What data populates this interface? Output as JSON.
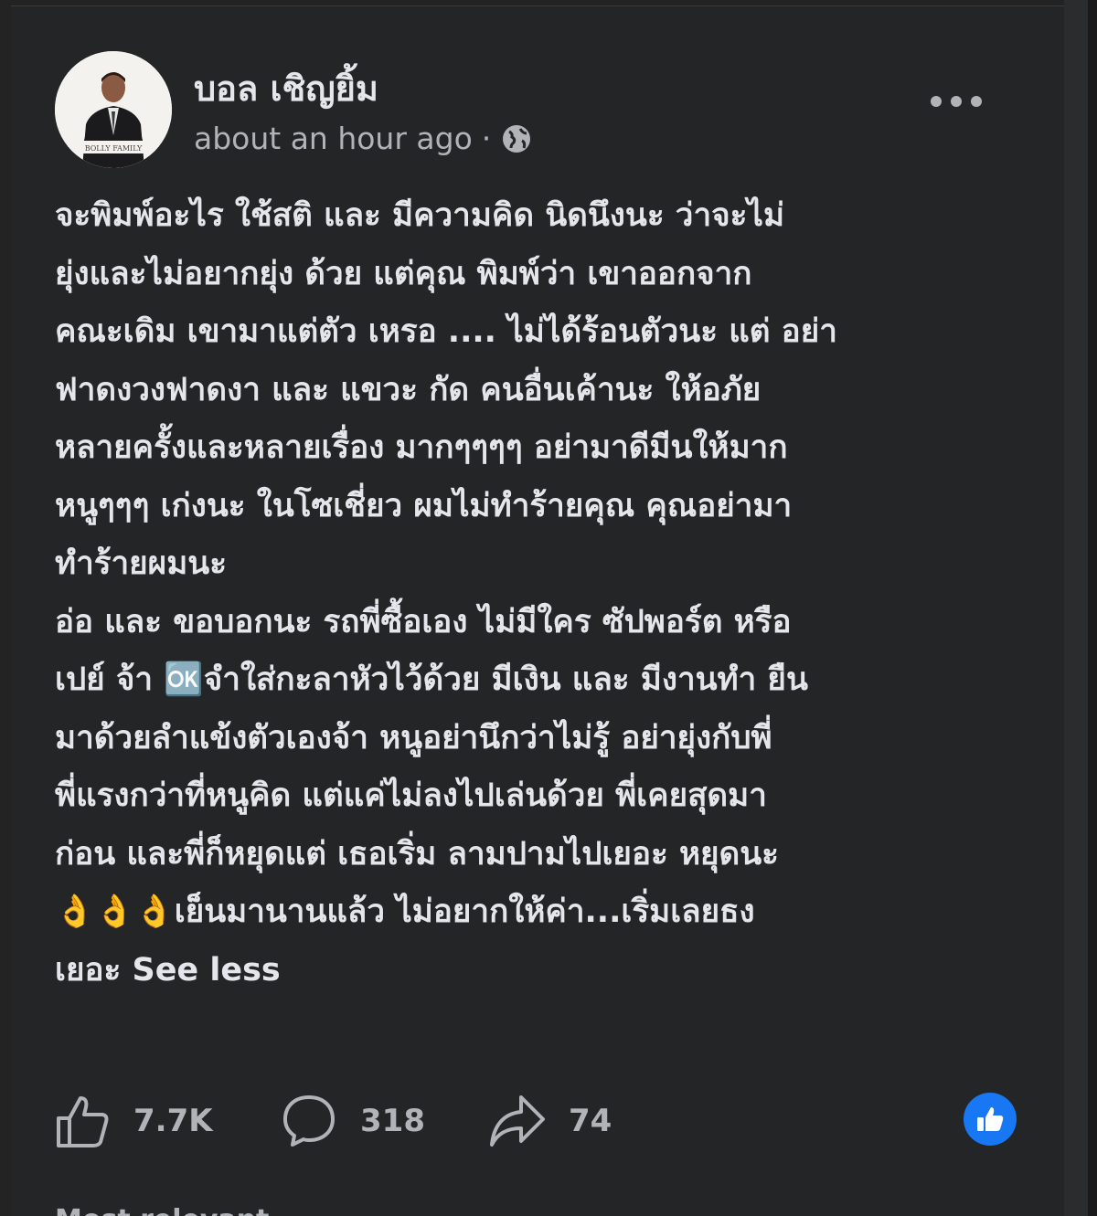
{
  "post": {
    "author": "บอล เชิญยิ้ม",
    "timestamp": "about an hour ago",
    "separator": "·",
    "visibility_icon": "globe-icon",
    "more_label": "•••",
    "body": "จะพิมพ์อะไร ใช้สติ และ มีความคิด นิดนึงนะ ว่าจะไม่\nยุ่งและไม่อยากยุ่ง ด้วย แต่คุณ พิมพ์ว่า เขาออกจาก\nคณะเดิม เขามาแต่ตัว เหรอ .... ไม่ได้ร้อนตัวนะ แต่ อย่า\nฟาดงวงฟาดงา และ แขวะ กัด คนอื่นเค้านะ ให้อภัย\nหลายครั้งและหลายเรื่อง มากๆๆๆๆ อย่ามาดีมีนให้มาก\nหนูๆๆๆ เก่งนะ ในโซเชี่ยว ผมไม่ทำร้ายคุณ คุณอย่ามา\nทำร้ายผมนะ\nอ่อ และ ขอบอกนะ รถพี่ซื้อเอง ไม่มีใคร ซัปพอร์ต หรือ\nเปย์ จ้า 🆗จำใส่กะลาหัวไว้ด้วย มีเงิน และ มีงานทำ ยืน\nมาด้วยลำแข้งตัวเองจ้า หนูอย่านึกว่าไม่รู้ อย่ายุ่งกับพี่\nพี่แรงกว่าที่หนูคิด แต่แค่ไม่ลงไปเล่นด้วย พี่เคยสุดมา\nก่อน และพี่ก็หยุดแต่ เธอเริ่ม ลามปามไปเยอะ หยุดนะ\n👌👌👌เย็นมานานแล้ว ไม่อยากให้ค่า...เริ่มเลยธง\nเยอะ ",
    "see_less": "See less"
  },
  "stats": {
    "likes": "7.7K",
    "comments": "318",
    "shares": "74"
  },
  "icons": {
    "like": "like-icon",
    "comment": "comment-icon",
    "share": "share-icon",
    "reaction": "thumbs-up-reaction-icon"
  },
  "colors": {
    "background": "#242526",
    "text": "#e4e6eb",
    "secondary_text": "#b0b3b8",
    "accent": "#1877f2"
  },
  "footer": {
    "peek": "Most relevant"
  }
}
